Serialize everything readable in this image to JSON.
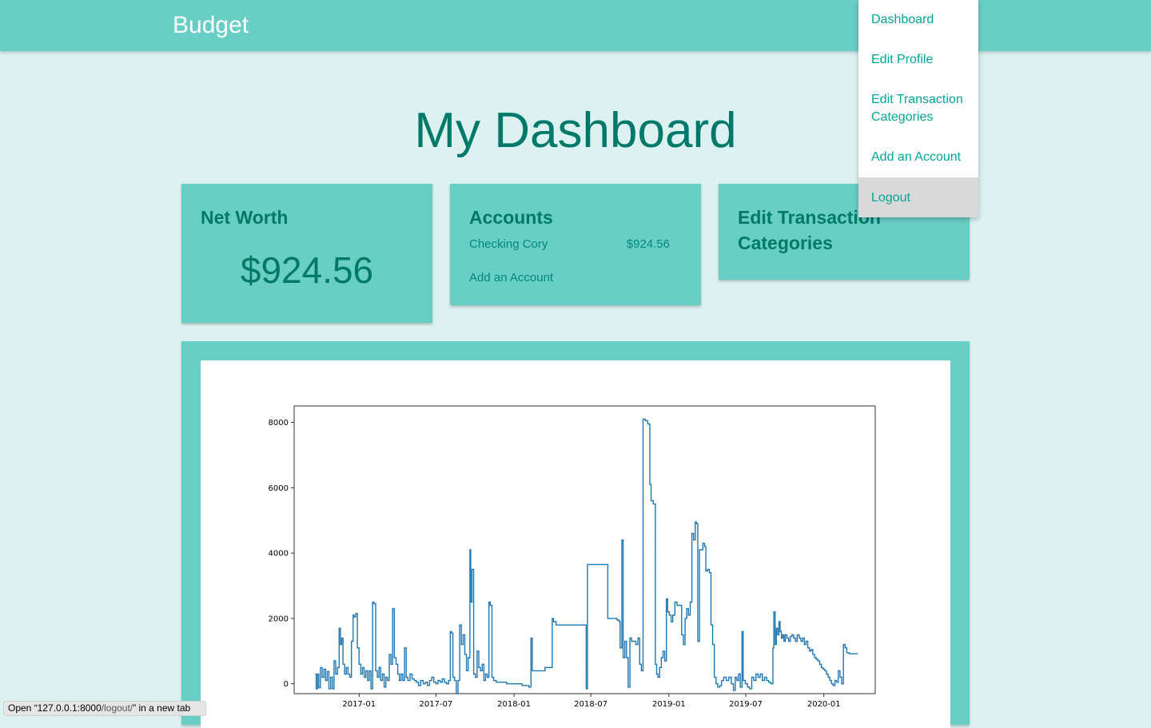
{
  "app": {
    "brand": "Budget"
  },
  "page": {
    "title": "My Dashboard"
  },
  "networth": {
    "title": "Net Worth",
    "value": "$924.56"
  },
  "accounts": {
    "title": "Accounts",
    "items": [
      {
        "name": "Checking Cory",
        "balance": "$924.56"
      }
    ],
    "add_label": "Add an Account"
  },
  "categories_card": {
    "title_line1": "Edit Transaction",
    "title_line2": "Categories"
  },
  "nav_menu": {
    "items": [
      {
        "label": "Dashboard"
      },
      {
        "label_line1": "Edit Profile"
      },
      {
        "label_line1": "Edit Transaction",
        "label_line2": "Categories"
      },
      {
        "label": "Add an Account"
      },
      {
        "label": "Logout",
        "highlighted": true
      }
    ]
  },
  "status_bar": {
    "prefix": "Open “127.0.0.1:8000",
    "path": "/logout/",
    "suffix": "” in a new tab"
  },
  "colors": {
    "primary": "#69cec6",
    "background": "#dcf2f0",
    "heading": "#00796b",
    "link": "#00a596",
    "line": "#1f77b4"
  },
  "chart_data": {
    "type": "line",
    "title": "",
    "xlabel": "",
    "ylabel": "",
    "xlim": [
      "2016-08-01",
      "2020-05-01"
    ],
    "ylim": [
      -300,
      8500
    ],
    "yticks": [
      0,
      2000,
      4000,
      6000,
      8000
    ],
    "xticks": [
      "2017-01",
      "2017-07",
      "2018-01",
      "2018-07",
      "2019-01",
      "2019-07",
      "2020-01"
    ],
    "grid": false,
    "legend": false,
    "series": [
      {
        "color": "#1f77b4",
        "points": [
          [
            "2016-09-20",
            300
          ],
          [
            "2016-09-22",
            -150
          ],
          [
            "2016-09-25",
            300
          ],
          [
            "2016-09-28",
            -120
          ],
          [
            "2016-10-02",
            500
          ],
          [
            "2016-10-06",
            200
          ],
          [
            "2016-10-10",
            450
          ],
          [
            "2016-10-14",
            100
          ],
          [
            "2016-10-18",
            380
          ],
          [
            "2016-10-22",
            -150
          ],
          [
            "2016-10-26",
            200
          ],
          [
            "2016-10-30",
            -150
          ],
          [
            "2016-11-03",
            700
          ],
          [
            "2016-11-07",
            300
          ],
          [
            "2016-11-11",
            500
          ],
          [
            "2016-11-15",
            1700
          ],
          [
            "2016-11-18",
            1200
          ],
          [
            "2016-11-21",
            1400
          ],
          [
            "2016-11-24",
            600
          ],
          [
            "2016-11-28",
            300
          ],
          [
            "2016-12-02",
            500
          ],
          [
            "2016-12-06",
            300
          ],
          [
            "2016-12-10",
            200
          ],
          [
            "2016-12-14",
            1300
          ],
          [
            "2016-12-18",
            2100
          ],
          [
            "2016-12-20",
            2050
          ],
          [
            "2016-12-24",
            2150
          ],
          [
            "2016-12-28",
            1100
          ],
          [
            "2017-01-01",
            600
          ],
          [
            "2017-01-05",
            300
          ],
          [
            "2017-01-09",
            500
          ],
          [
            "2017-01-13",
            200
          ],
          [
            "2017-01-17",
            400
          ],
          [
            "2017-01-21",
            100
          ],
          [
            "2017-01-25",
            400
          ],
          [
            "2017-01-29",
            -150
          ],
          [
            "2017-02-02",
            2500
          ],
          [
            "2017-02-05",
            2450
          ],
          [
            "2017-02-09",
            400
          ],
          [
            "2017-02-13",
            200
          ],
          [
            "2017-02-17",
            500
          ],
          [
            "2017-02-21",
            100
          ],
          [
            "2017-02-25",
            300
          ],
          [
            "2017-03-01",
            -100
          ],
          [
            "2017-03-05",
            200
          ],
          [
            "2017-03-09",
            100
          ],
          [
            "2017-03-13",
            900
          ],
          [
            "2017-03-17",
            600
          ],
          [
            "2017-03-21",
            2300
          ],
          [
            "2017-03-25",
            800
          ],
          [
            "2017-03-29",
            600
          ],
          [
            "2017-04-02",
            300
          ],
          [
            "2017-04-06",
            100
          ],
          [
            "2017-04-10",
            300
          ],
          [
            "2017-04-14",
            100
          ],
          [
            "2017-04-18",
            1100
          ],
          [
            "2017-04-22",
            200
          ],
          [
            "2017-04-26",
            100
          ],
          [
            "2017-05-01",
            300
          ],
          [
            "2017-05-06",
            150
          ],
          [
            "2017-05-11",
            100
          ],
          [
            "2017-05-16",
            50
          ],
          [
            "2017-05-21",
            -50
          ],
          [
            "2017-05-26",
            100
          ],
          [
            "2017-06-01",
            0
          ],
          [
            "2017-06-06",
            50
          ],
          [
            "2017-06-11",
            -50
          ],
          [
            "2017-06-16",
            100
          ],
          [
            "2017-06-21",
            200
          ],
          [
            "2017-06-26",
            50
          ],
          [
            "2017-07-01",
            0
          ],
          [
            "2017-07-06",
            100
          ],
          [
            "2017-07-11",
            50
          ],
          [
            "2017-07-16",
            150
          ],
          [
            "2017-07-21",
            50
          ],
          [
            "2017-07-26",
            0
          ],
          [
            "2017-07-31",
            100
          ],
          [
            "2017-08-04",
            1600
          ],
          [
            "2017-08-07",
            1550
          ],
          [
            "2017-08-10",
            200
          ],
          [
            "2017-08-14",
            100
          ],
          [
            "2017-08-18",
            -300
          ],
          [
            "2017-08-22",
            100
          ],
          [
            "2017-08-26",
            1800
          ],
          [
            "2017-08-30",
            1200
          ],
          [
            "2017-09-03",
            1500
          ],
          [
            "2017-09-07",
            900
          ],
          [
            "2017-09-11",
            400
          ],
          [
            "2017-09-15",
            800
          ],
          [
            "2017-09-19",
            4100
          ],
          [
            "2017-09-21",
            2500
          ],
          [
            "2017-09-24",
            3500
          ],
          [
            "2017-09-28",
            300
          ],
          [
            "2017-10-02",
            200
          ],
          [
            "2017-10-06",
            1000
          ],
          [
            "2017-10-10",
            500
          ],
          [
            "2017-10-14",
            400
          ],
          [
            "2017-10-18",
            600
          ],
          [
            "2017-10-22",
            100
          ],
          [
            "2017-10-26",
            300
          ],
          [
            "2017-10-30",
            200
          ],
          [
            "2017-11-03",
            2500
          ],
          [
            "2017-11-06",
            2400
          ],
          [
            "2017-11-10",
            200
          ],
          [
            "2017-11-14",
            100
          ],
          [
            "2017-11-20",
            50
          ],
          [
            "2017-12-01",
            50
          ],
          [
            "2017-12-15",
            0
          ],
          [
            "2018-01-01",
            0
          ],
          [
            "2018-01-20",
            -50
          ],
          [
            "2018-02-05",
            -100
          ],
          [
            "2018-02-10",
            1400
          ],
          [
            "2018-02-13",
            400
          ],
          [
            "2018-02-20",
            400
          ],
          [
            "2018-03-01",
            400
          ],
          [
            "2018-03-15",
            500
          ],
          [
            "2018-03-25",
            500
          ],
          [
            "2018-04-01",
            2000
          ],
          [
            "2018-04-04",
            1900
          ],
          [
            "2018-04-10",
            1800
          ],
          [
            "2018-05-01",
            1800
          ],
          [
            "2018-05-15",
            1800
          ],
          [
            "2018-05-30",
            1800
          ],
          [
            "2018-06-10",
            1800
          ],
          [
            "2018-06-20",
            -150
          ],
          [
            "2018-06-23",
            3650
          ],
          [
            "2018-07-10",
            3650
          ],
          [
            "2018-07-25",
            3650
          ],
          [
            "2018-08-05",
            3650
          ],
          [
            "2018-08-10",
            2000
          ],
          [
            "2018-08-20",
            2000
          ],
          [
            "2018-09-01",
            1950
          ],
          [
            "2018-09-06",
            1900
          ],
          [
            "2018-09-08",
            1100
          ],
          [
            "2018-09-12",
            4400
          ],
          [
            "2018-09-15",
            800
          ],
          [
            "2018-09-19",
            1300
          ],
          [
            "2018-09-23",
            800
          ],
          [
            "2018-09-27",
            -100
          ],
          [
            "2018-10-01",
            1400
          ],
          [
            "2018-10-05",
            1300
          ],
          [
            "2018-10-10",
            1300
          ],
          [
            "2018-10-15",
            1200
          ],
          [
            "2018-10-20",
            1400
          ],
          [
            "2018-10-24",
            600
          ],
          [
            "2018-10-28",
            400
          ],
          [
            "2018-11-01",
            8100
          ],
          [
            "2018-11-06",
            8050
          ],
          [
            "2018-11-12",
            7950
          ],
          [
            "2018-11-17",
            6100
          ],
          [
            "2018-11-20",
            5600
          ],
          [
            "2018-11-25",
            5500
          ],
          [
            "2018-11-30",
            600
          ],
          [
            "2018-12-03",
            300
          ],
          [
            "2018-12-06",
            200
          ],
          [
            "2018-12-10",
            500
          ],
          [
            "2018-12-14",
            800
          ],
          [
            "2018-12-18",
            1000
          ],
          [
            "2018-12-22",
            700
          ],
          [
            "2018-12-26",
            2600
          ],
          [
            "2018-12-29",
            2200
          ],
          [
            "2019-01-02",
            2100
          ],
          [
            "2019-01-06",
            1900
          ],
          [
            "2019-01-10",
            2100
          ],
          [
            "2019-01-15",
            2500
          ],
          [
            "2019-01-20",
            2400
          ],
          [
            "2019-01-25",
            2400
          ],
          [
            "2019-01-31",
            1500
          ],
          [
            "2019-02-04",
            1200
          ],
          [
            "2019-02-08",
            2000
          ],
          [
            "2019-02-12",
            2300
          ],
          [
            "2019-02-16",
            2100
          ],
          [
            "2019-02-20",
            2500
          ],
          [
            "2019-02-24",
            4600
          ],
          [
            "2019-02-28",
            4400
          ],
          [
            "2019-03-04",
            4950
          ],
          [
            "2019-03-07",
            4900
          ],
          [
            "2019-03-10",
            1300
          ],
          [
            "2019-03-14",
            4100
          ],
          [
            "2019-03-18",
            4100
          ],
          [
            "2019-03-22",
            4300
          ],
          [
            "2019-03-26",
            4200
          ],
          [
            "2019-03-29",
            3450
          ],
          [
            "2019-04-02",
            3500
          ],
          [
            "2019-04-06",
            3400
          ],
          [
            "2019-04-10",
            1800
          ],
          [
            "2019-04-14",
            1200
          ],
          [
            "2019-04-18",
            200
          ],
          [
            "2019-04-22",
            0
          ],
          [
            "2019-04-26",
            -100
          ],
          [
            "2019-05-01",
            -50
          ],
          [
            "2019-05-05",
            100
          ],
          [
            "2019-05-10",
            200
          ],
          [
            "2019-05-16",
            100
          ],
          [
            "2019-05-22",
            200
          ],
          [
            "2019-05-28",
            0
          ],
          [
            "2019-06-02",
            -200
          ],
          [
            "2019-06-06",
            200
          ],
          [
            "2019-06-10",
            100
          ],
          [
            "2019-06-14",
            300
          ],
          [
            "2019-06-18",
            -100
          ],
          [
            "2019-06-22",
            1600
          ],
          [
            "2019-06-25",
            100
          ],
          [
            "2019-06-30",
            0
          ],
          [
            "2019-07-05",
            -100
          ],
          [
            "2019-07-10",
            -150
          ],
          [
            "2019-07-15",
            200
          ],
          [
            "2019-07-20",
            100
          ],
          [
            "2019-07-25",
            300
          ],
          [
            "2019-07-30",
            200
          ],
          [
            "2019-08-04",
            300
          ],
          [
            "2019-08-09",
            100
          ],
          [
            "2019-08-14",
            200
          ],
          [
            "2019-08-19",
            100
          ],
          [
            "2019-08-24",
            50
          ],
          [
            "2019-08-29",
            0
          ],
          [
            "2019-09-03",
            1100
          ],
          [
            "2019-09-05",
            2200
          ],
          [
            "2019-09-08",
            1200
          ],
          [
            "2019-09-11",
            1700
          ],
          [
            "2019-09-14",
            1500
          ],
          [
            "2019-09-17",
            1900
          ],
          [
            "2019-09-20",
            1600
          ],
          [
            "2019-09-23",
            1400
          ],
          [
            "2019-09-26",
            1500
          ],
          [
            "2019-09-29",
            1300
          ],
          [
            "2019-10-02",
            1500
          ],
          [
            "2019-10-06",
            1400
          ],
          [
            "2019-10-10",
            1300
          ],
          [
            "2019-10-14",
            1450
          ],
          [
            "2019-10-18",
            1500
          ],
          [
            "2019-10-22",
            1400
          ],
          [
            "2019-10-26",
            1300
          ],
          [
            "2019-10-30",
            1500
          ],
          [
            "2019-11-04",
            1400
          ],
          [
            "2019-11-08",
            1300
          ],
          [
            "2019-11-12",
            1400
          ],
          [
            "2019-11-16",
            1200
          ],
          [
            "2019-11-20",
            1300
          ],
          [
            "2019-11-24",
            1100
          ],
          [
            "2019-11-28",
            1000
          ],
          [
            "2019-12-02",
            1050
          ],
          [
            "2019-12-06",
            900
          ],
          [
            "2019-12-10",
            800
          ],
          [
            "2019-12-14",
            750
          ],
          [
            "2019-12-18",
            700
          ],
          [
            "2019-12-22",
            600
          ],
          [
            "2019-12-26",
            500
          ],
          [
            "2019-12-30",
            450
          ],
          [
            "2020-01-03",
            400
          ],
          [
            "2020-01-07",
            300
          ],
          [
            "2020-01-11",
            200
          ],
          [
            "2020-01-15",
            100
          ],
          [
            "2020-01-19",
            0
          ],
          [
            "2020-01-23",
            -50
          ],
          [
            "2020-01-27",
            100
          ],
          [
            "2020-01-31",
            50
          ],
          [
            "2020-02-04",
            400
          ],
          [
            "2020-02-08",
            200
          ],
          [
            "2020-02-12",
            0
          ],
          [
            "2020-02-16",
            1200
          ],
          [
            "2020-02-20",
            1100
          ],
          [
            "2020-02-24",
            950
          ],
          [
            "2020-03-01",
            920
          ],
          [
            "2020-03-10",
            920
          ],
          [
            "2020-03-20",
            925
          ]
        ]
      }
    ]
  }
}
